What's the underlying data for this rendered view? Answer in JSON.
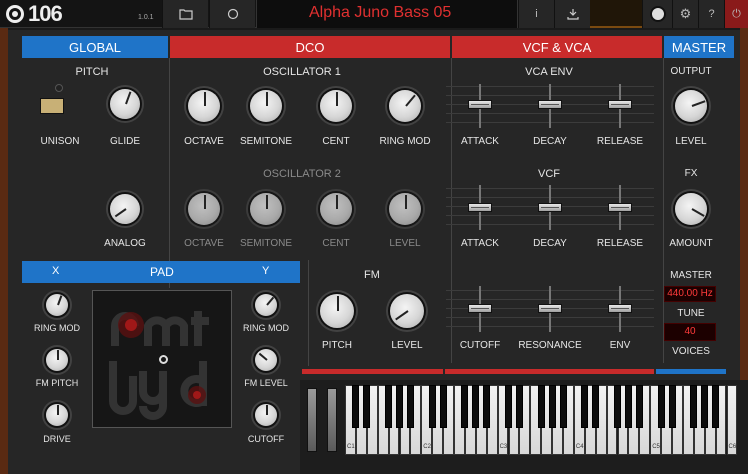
{
  "app": {
    "logo": "106",
    "version": "1.0.1",
    "preset_name": "Alpha Juno Bass 05"
  },
  "toolbar": {
    "info_label": "i",
    "help_label": "?"
  },
  "sections": {
    "global": "GLOBAL",
    "dco": "DCO",
    "vcf_vca": "VCF & VCA",
    "master": "MASTER"
  },
  "global": {
    "title": "PITCH",
    "unison": "UNISON",
    "glide": "GLIDE",
    "analog": "ANALOG"
  },
  "dco": {
    "osc1_title": "OSCILLATOR 1",
    "osc1": [
      "OCTAVE",
      "SEMITONE",
      "CENT",
      "RING MOD"
    ],
    "osc2_title": "OSCILLATOR 2",
    "osc2": [
      "OCTAVE",
      "SEMITONE",
      "CENT",
      "LEVEL"
    ],
    "fm_title": "FM",
    "fm": [
      "PITCH",
      "LEVEL"
    ]
  },
  "vca_env": {
    "title": "VCA ENV",
    "labels": [
      "ATTACK",
      "DECAY",
      "RELEASE"
    ]
  },
  "vcf": {
    "title": "VCF",
    "labels": [
      "ATTACK",
      "DECAY",
      "RELEASE"
    ],
    "labels2": [
      "CUTOFF",
      "RESONANCE",
      "ENV"
    ]
  },
  "master": {
    "output_title": "OUTPUT",
    "level": "LEVEL",
    "fx_title": "FX",
    "amount": "AMOUNT",
    "master_title": "MASTER",
    "tune_value": "440.00 Hz",
    "tune": "TUNE",
    "voices_value": "40",
    "voices": "VOICES"
  },
  "pad": {
    "x": "X",
    "title": "PAD",
    "y": "Y",
    "left": [
      "RING MOD",
      "FM PITCH",
      "DRIVE"
    ],
    "right": [
      "RING MOD",
      "FM LEVEL",
      "CUTOFF"
    ]
  },
  "keyboard": {
    "octaves": [
      "C1",
      "C2",
      "C3",
      "C4",
      "C5",
      "C6"
    ]
  },
  "colors": {
    "blue": "#1f74c8",
    "red": "#c82b2b",
    "display": "#ff3a3a"
  }
}
